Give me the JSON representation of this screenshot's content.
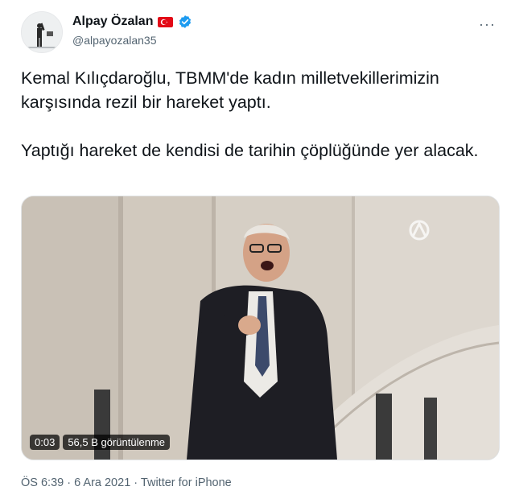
{
  "author": {
    "display_name": "Alpay Özalan",
    "handle": "@alpayozalan35",
    "flag_icon": "turkey-flag-icon",
    "verified_icon": "verified-badge-icon",
    "verified_color": "#1d9bf0"
  },
  "menu": {
    "more_label": "···"
  },
  "tweet": {
    "paragraph1": "Kemal Kılıçdaroğlu, TBMM'de kadın milletvekillerimizin karşısında rezil bir hareket yaptı.",
    "paragraph2": "Yaptığı hareket de kendisi de tarihin çöplüğünde yer alacak."
  },
  "media": {
    "duration": "0:03",
    "views": "56,5 B görüntülenme",
    "watermark_icon": "anadolu-agency-logo-icon"
  },
  "footer": {
    "time": "ÖS 6:39",
    "separator1": "·",
    "date": "6 Ara 2021",
    "separator2": "·",
    "source": "Twitter for iPhone"
  },
  "colors": {
    "text": "#0f1419",
    "secondary": "#536471",
    "flag_red": "#e30a17"
  }
}
